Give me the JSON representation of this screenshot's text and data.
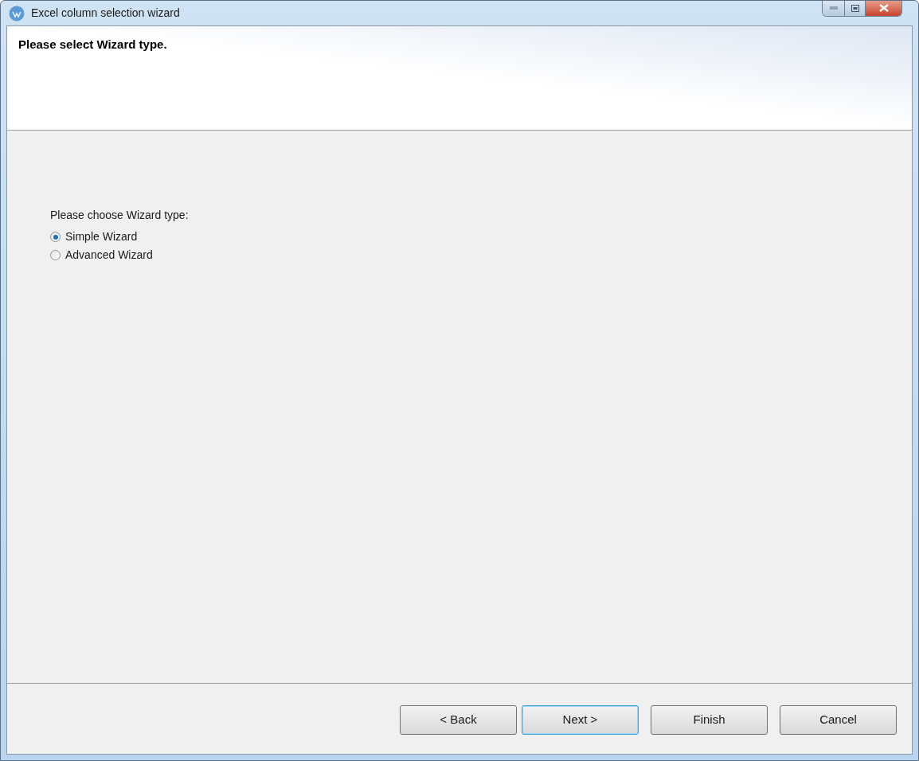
{
  "window": {
    "title": "Excel column selection wizard"
  },
  "header": {
    "title": "Please select Wizard type."
  },
  "body": {
    "prompt": "Please choose Wizard type:",
    "options": [
      {
        "label": "Simple Wizard",
        "selected": true
      },
      {
        "label": "Advanced Wizard",
        "selected": false
      }
    ]
  },
  "buttons": [
    {
      "label": "< Back",
      "focused": false
    },
    {
      "label": "Next >",
      "focused": true
    },
    {
      "label": "Finish",
      "focused": false
    },
    {
      "label": "Cancel",
      "focused": false
    }
  ]
}
